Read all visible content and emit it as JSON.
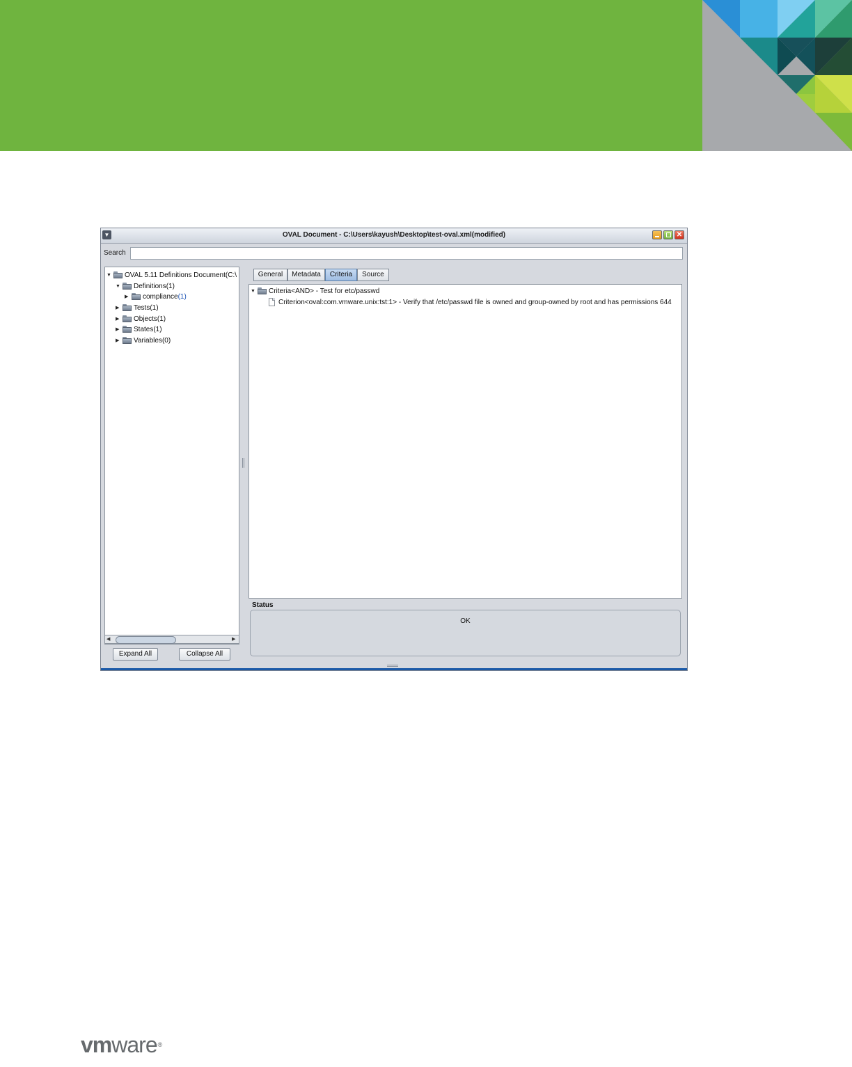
{
  "colors": {
    "banner": "#6fb43f",
    "logo": "#666a6d",
    "window_accent": "#1b5aa8"
  },
  "window": {
    "title": "OVAL Document - C:\\Users\\kayush\\Desktop\\test-oval.xml(modified)",
    "menu_icon": "chevron-down-icon",
    "close_glyph": "✕"
  },
  "search": {
    "label": "Search",
    "value": ""
  },
  "tree": {
    "root": "OVAL 5.11 Definitions Document(C:\\",
    "definitions": "Definitions(1)",
    "compliance_name": "compliance",
    "compliance_count": "(1)",
    "tests": "Tests(1)",
    "objects": "Objects(1)",
    "states": "States(1)",
    "variables": "Variables(0)"
  },
  "buttons": {
    "expand_all": "Expand All",
    "collapse_all": "Collapse All"
  },
  "tabs": [
    "General",
    "Metadata",
    "Criteria",
    "Source"
  ],
  "active_tab": "Criteria",
  "criteria": {
    "node": "Criteria<AND> - Test for etc/passwd",
    "criterion": "Criterion<oval:com.vmware.unix:tst:1> - Verify that /etc/passwd file is owned and group-owned by root and has permissions 644"
  },
  "status": {
    "label": "Status",
    "text": "OK"
  },
  "logo": {
    "vm": "vm",
    "ware": "ware",
    "reg": "®"
  }
}
